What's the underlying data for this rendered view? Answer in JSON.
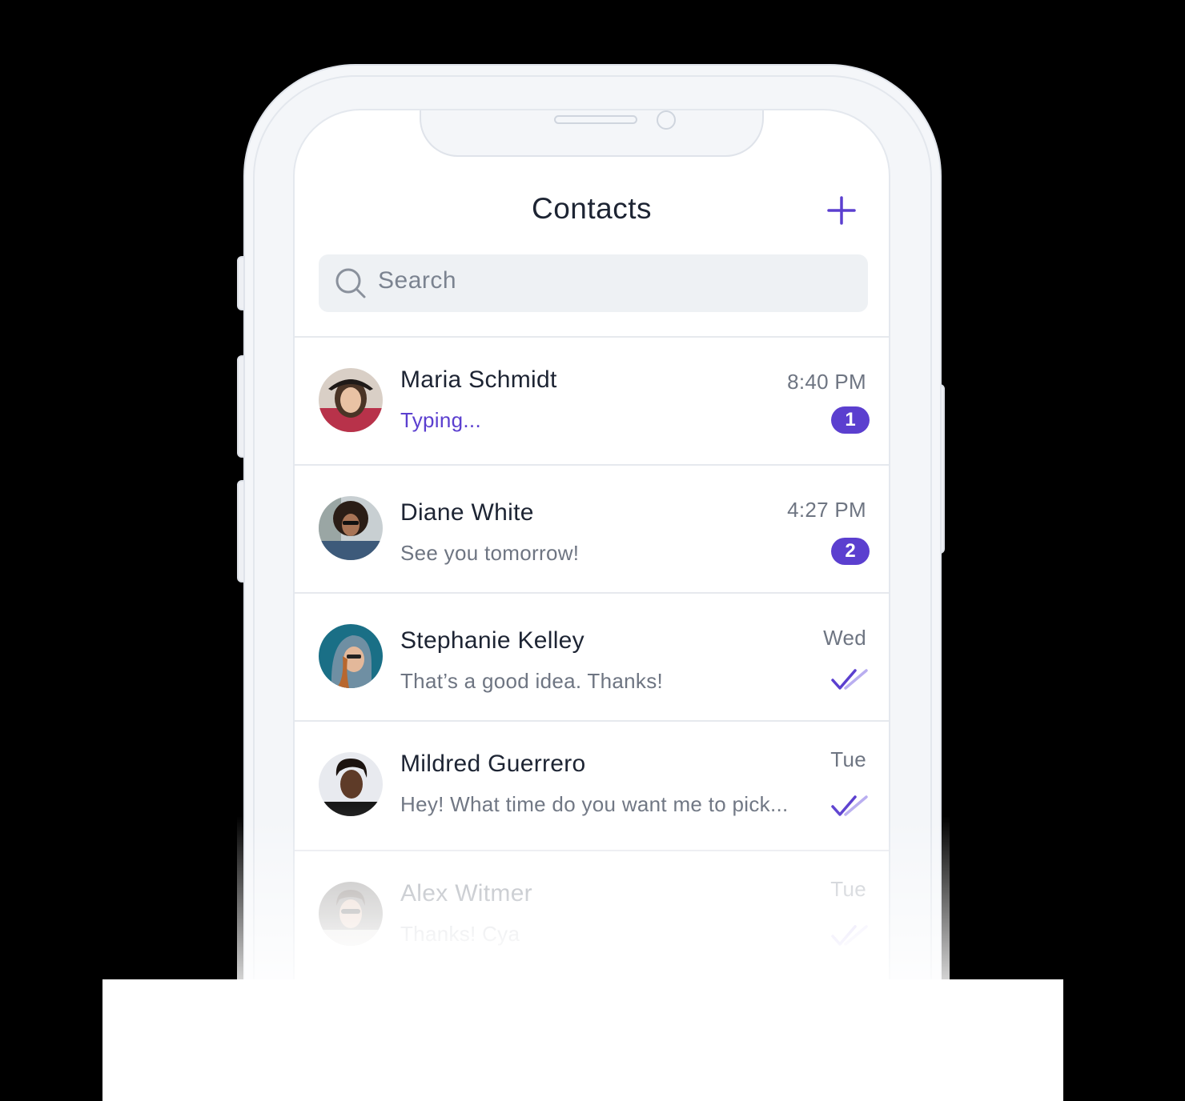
{
  "header": {
    "title": "Contacts"
  },
  "search": {
    "placeholder": "Search"
  },
  "contacts": [
    {
      "name": "Maria Schmidt",
      "message": "Typing...",
      "time": "8:40 PM",
      "badge": "1",
      "status": "typing"
    },
    {
      "name": "Diane White",
      "message": "See you tomorrow!",
      "time": "4:27 PM",
      "badge": "2",
      "status": "unread"
    },
    {
      "name": "Stephanie Kelley",
      "message": "That’s a good idea. Thanks!",
      "time": "Wed",
      "status": "read"
    },
    {
      "name": "Mildred Guerrero",
      "message": "Hey! What time do you want me to pick...",
      "time": "Tue",
      "status": "read"
    },
    {
      "name": "Alex Witmer",
      "message": "Thanks! Cya",
      "time": "Tue",
      "status": "read"
    }
  ],
  "colors": {
    "accent": "#5b3fcf",
    "text": "#1d2433",
    "muted": "#6e7582",
    "search_bg": "#eef1f4"
  },
  "icons": {
    "add": "plus-icon",
    "search": "search-icon",
    "read": "double-check-icon"
  }
}
